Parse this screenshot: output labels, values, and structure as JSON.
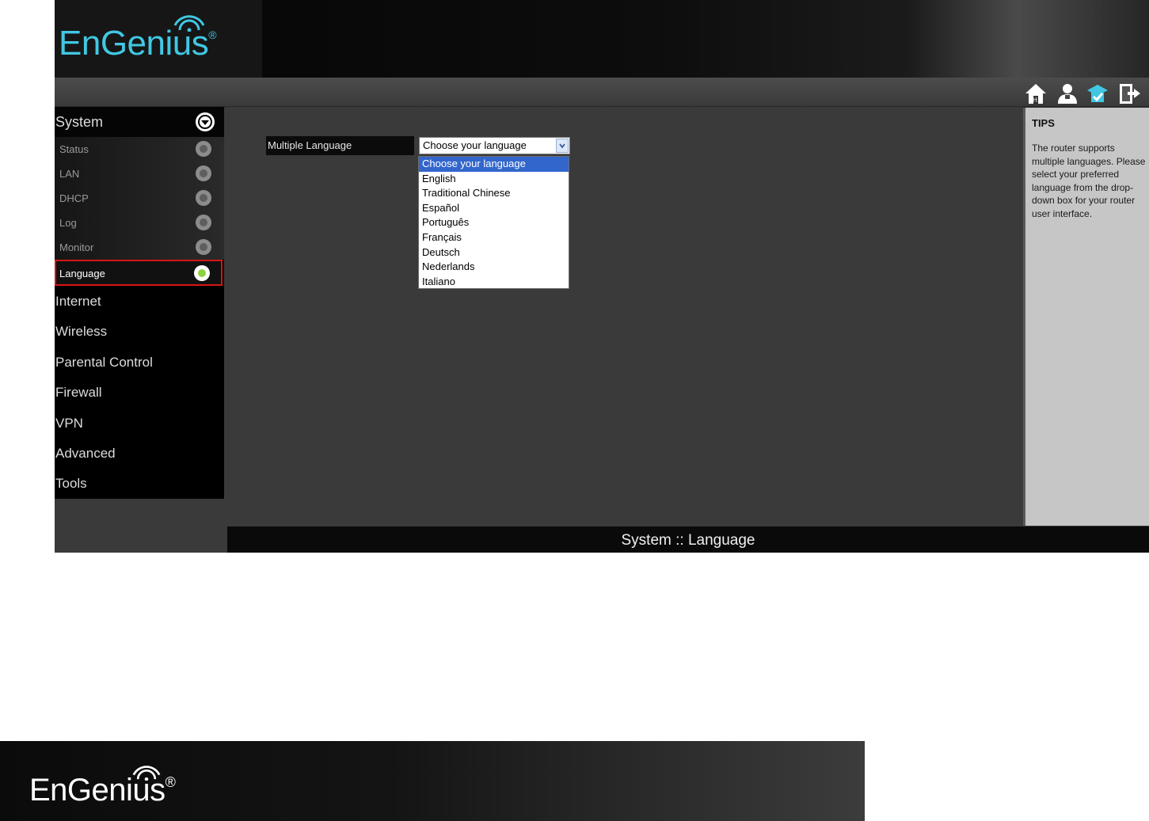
{
  "brand": {
    "name": "EnGenius",
    "reg": "®"
  },
  "toolbar": {
    "icons": [
      "home-icon",
      "user-icon",
      "wizard-icon",
      "logout-icon"
    ]
  },
  "sidebar": {
    "system": "System",
    "sub_items": [
      {
        "label": "Status"
      },
      {
        "label": "LAN"
      },
      {
        "label": "DHCP"
      },
      {
        "label": "Log"
      },
      {
        "label": "Monitor"
      }
    ],
    "active_item": "Language",
    "main_items": [
      "Internet",
      "Wireless",
      "Parental Control",
      "Firewall",
      "VPN",
      "Advanced",
      "Tools"
    ]
  },
  "form": {
    "label": "Multiple Language",
    "select_value": "Choose your language",
    "options": [
      "Choose your language",
      "English",
      "Traditional Chinese",
      "Español",
      "Português",
      "Français",
      "Deutsch",
      "Nederlands",
      "Italiano"
    ],
    "highlighted_index": 0
  },
  "tips": {
    "title": "TIPS",
    "body": "The router supports multiple languages. Please select your preferred language from the drop-down box for your router user interface."
  },
  "footer": "System :: Language",
  "colors": {
    "accent": "#41c7e3",
    "highlight": "#3366cc",
    "active_border": "#d81414",
    "active_dot": "#8ed23e"
  }
}
